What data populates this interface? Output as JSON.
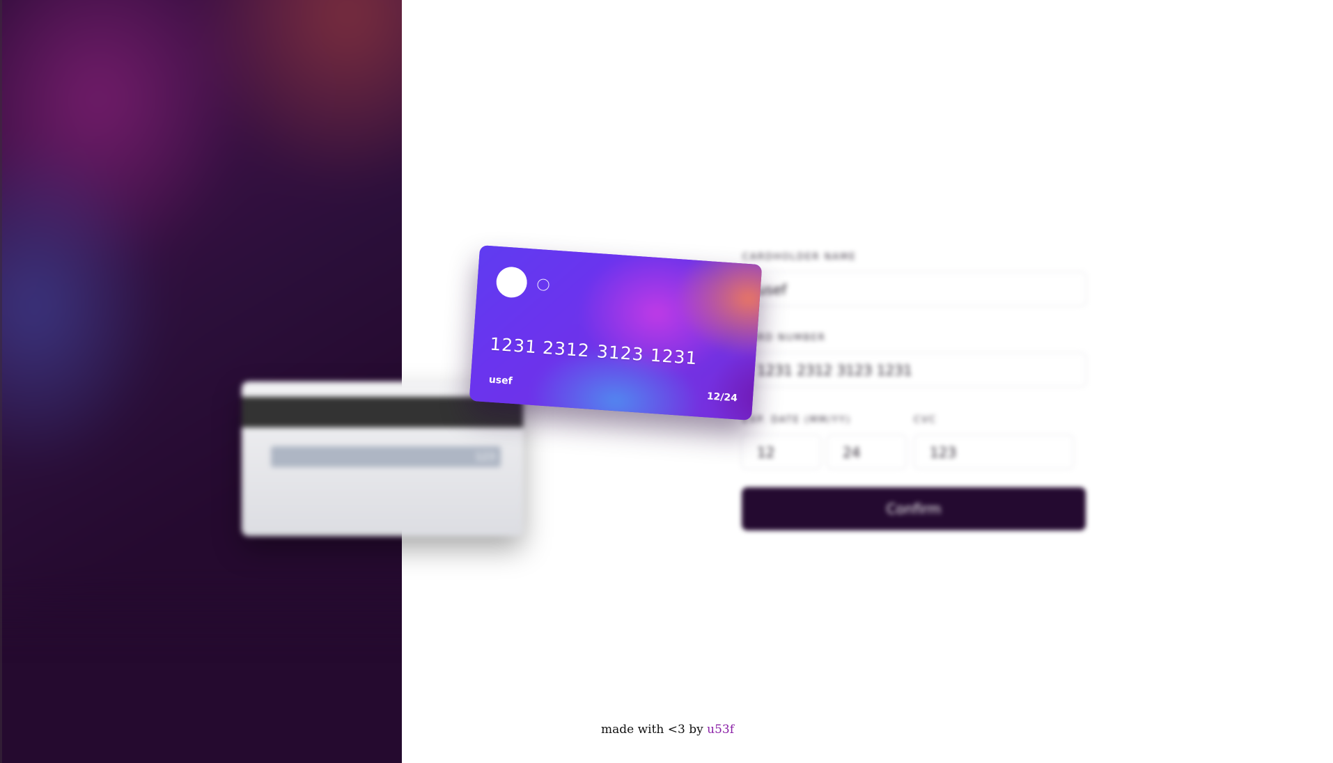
{
  "card_front": {
    "number_groups": [
      "1231",
      "2312",
      "3123",
      "1231"
    ],
    "holder": "usef",
    "expiry": "12/24"
  },
  "card_back": {
    "cvv": "123",
    "fine_print_line1": "",
    "fine_print_line2": ""
  },
  "form": {
    "cardholder_label": "CARDHOLDER NAME",
    "cardholder_value": "usef",
    "number_label": "CARD NUMBER",
    "number_value": "1231 2312 3123 1231",
    "expiry_label": "EXP. DATE (MM/YY)",
    "month_value": "12",
    "year_value": "24",
    "cvc_label": "CVC",
    "cvc_value": "123",
    "confirm_label": "Confirm"
  },
  "footer": {
    "text": "made with <3 by",
    "author": "u53f"
  },
  "colors": {
    "panel_dark": "#250a2f",
    "button": "#240a30",
    "author_link": "#8a1fa6"
  }
}
